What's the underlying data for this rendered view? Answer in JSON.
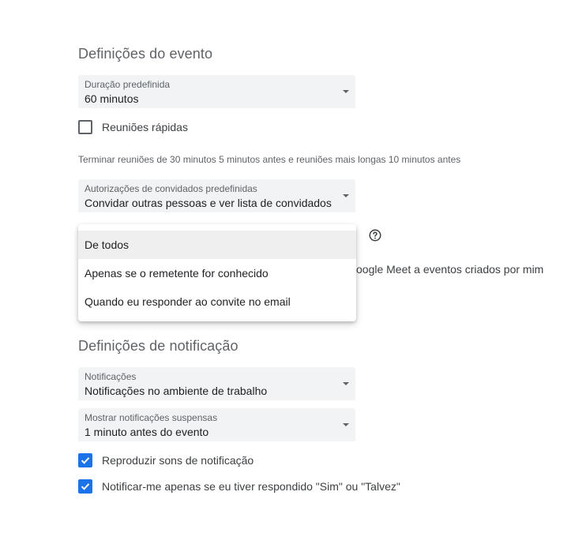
{
  "event_settings": {
    "heading": "Definições do evento",
    "duration": {
      "label": "Duração predefinida",
      "value": "60 minutos"
    },
    "speedy_meetings": {
      "label": "Reuniões rápidas",
      "checked": false
    },
    "speedy_hint": "Terminar reuniões de 30 minutos 5 minutos antes e reuniões mais longas 10 minutos antes",
    "guest_permissions": {
      "label": "Autorizações de convidados predefinidas",
      "value": "Convidar outras pessoas e ver lista de convidados"
    },
    "meet_text_partial": "oogle Meet a eventos criados por mim"
  },
  "dropdown_menu": {
    "items": [
      "De todos",
      "Apenas se o remetente for conhecido",
      "Quando eu responder ao convite no email"
    ],
    "selected_index": 0
  },
  "notification_settings": {
    "heading": "Definições de notificação",
    "notifications": {
      "label": "Notificações",
      "value": "Notificações no ambiente de trabalho"
    },
    "snoozed": {
      "label": "Mostrar notificações suspensas",
      "value": "1 minuto antes do evento"
    },
    "play_sounds": {
      "label": "Reproduzir sons de notificação",
      "checked": true
    },
    "notify_if_responded": {
      "label": "Notificar-me apenas se eu tiver respondido \"Sim\" ou \"Talvez\"",
      "checked": true
    }
  },
  "colors": {
    "accent": "#1a73e8",
    "field_bg": "#f1f3f4"
  },
  "icons": [
    "dropdown-caret-icon",
    "help-icon",
    "checkmark-icon"
  ]
}
